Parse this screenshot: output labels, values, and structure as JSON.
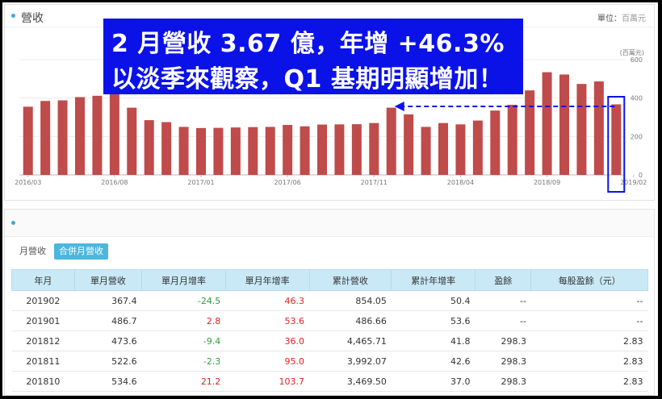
{
  "chart_panel": {
    "title": "營收",
    "unit_label": "單位：",
    "unit_value": "百萬元"
  },
  "banner": {
    "line1": "2 月營收 3.67 億，年增 +46.3%",
    "line2": "以淡季來觀察，Q1 基期明顯增加！"
  },
  "chart_data": {
    "type": "bar",
    "title": "營收",
    "ylabel": "(百萬元)",
    "ylim": [
      0,
      600
    ],
    "yticks": [
      0,
      200,
      400,
      600
    ],
    "x_tick_labels": [
      {
        "index": 0,
        "label": "2016/03"
      },
      {
        "index": 5,
        "label": "2016/08"
      },
      {
        "index": 10,
        "label": "2017/01"
      },
      {
        "index": 15,
        "label": "2017/06"
      },
      {
        "index": 20,
        "label": "2017/11"
      },
      {
        "index": 25,
        "label": "2018/04"
      },
      {
        "index": 30,
        "label": "2018/09"
      },
      {
        "index": 35,
        "label": "2019/02"
      }
    ],
    "categories": [
      "2016/03",
      "2016/04",
      "2016/05",
      "2016/06",
      "2016/07",
      "2016/08",
      "2016/09",
      "2016/10",
      "2016/11",
      "2016/12",
      "2017/01",
      "2017/02",
      "2017/03",
      "2017/04",
      "2017/05",
      "2017/06",
      "2017/07",
      "2017/08",
      "2017/09",
      "2017/10",
      "2017/11",
      "2017/12",
      "2018/01",
      "2018/02",
      "2018/03",
      "2018/04",
      "2018/05",
      "2018/06",
      "2018/07",
      "2018/08",
      "2018/09",
      "2018/10",
      "2018/11",
      "2018/12",
      "2019/01",
      "2019/02"
    ],
    "values": [
      355,
      385,
      388,
      405,
      412,
      420,
      350,
      285,
      275,
      250,
      244,
      245,
      247,
      249,
      250,
      260,
      253,
      262,
      263,
      264,
      270,
      350,
      315,
      250,
      270,
      263,
      283,
      335,
      365,
      440,
      534.6,
      522.6,
      473.6,
      486.7,
      367.4
    ],
    "color": "#bf4b4b",
    "annotation": "dashed arrow from 2019/02 bar toward 2018/02 level; 2019/02 bar highlighted with blue box"
  },
  "monthly_panel": {
    "tabs": [
      {
        "label": "月營收",
        "active": false
      },
      {
        "label": "合併月營收",
        "active": true
      }
    ]
  },
  "table": {
    "headers": [
      "年月",
      "單月營收",
      "單月月增率",
      "單月年增率",
      "累計營收",
      "累計年增率",
      "盈餘",
      "每股盈餘（元）"
    ],
    "rows": [
      [
        "201902",
        "367.4",
        "-24.5",
        "46.3",
        "854.05",
        "50.4",
        "--",
        "--"
      ],
      [
        "201901",
        "486.7",
        "2.8",
        "53.6",
        "486.66",
        "53.6",
        "--",
        "--"
      ],
      [
        "201812",
        "473.6",
        "-9.4",
        "36.0",
        "4,465.71",
        "41.8",
        "298.3",
        "2.83"
      ],
      [
        "201811",
        "522.6",
        "-2.3",
        "95.0",
        "3,992.07",
        "42.6",
        "298.3",
        "2.83"
      ],
      [
        "201810",
        "534.6",
        "21.2",
        "103.7",
        "3,469.50",
        "37.0",
        "298.3",
        "2.83"
      ]
    ]
  },
  "colors": {
    "bar": "#bf4b4b",
    "banner": "#0b12e8",
    "header_bg": "#c9e9f6",
    "negative": "#2e9e3e",
    "positive": "#e22222",
    "accent": "#4bb7df"
  }
}
